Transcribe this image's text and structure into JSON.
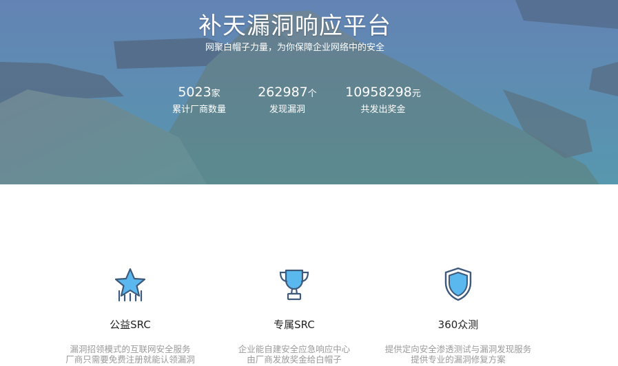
{
  "hero": {
    "title": "补天漏洞响应平台",
    "subtitle": "网聚白帽子力量，为你保障企业网络中的安全",
    "stats": [
      {
        "value": "5023",
        "unit": "家",
        "label": "累计厂商数量"
      },
      {
        "value": "262987",
        "unit": "个",
        "label": "发现漏洞"
      },
      {
        "value": "10958298",
        "unit": "元",
        "label": "共发出奖金"
      }
    ]
  },
  "features": [
    {
      "icon": "star-icon",
      "title": "公益SRC",
      "lines": [
        "漏洞招领模式的互联网安全服务",
        "厂商只需要免费注册就能认领漏洞"
      ]
    },
    {
      "icon": "trophy-icon",
      "title": "专属SRC",
      "lines": [
        "企业能自建安全应急响应中心",
        "由厂商发放奖金给白帽子"
      ]
    },
    {
      "icon": "shield-icon",
      "title": "360众测",
      "lines": [
        "提供定向安全渗透测试与漏洞发现服务",
        "提供专业的漏洞修复方案"
      ]
    }
  ],
  "colors": {
    "icon_stroke": "#3d5a7a",
    "icon_fill": "#5ab8ee",
    "hero_tint": "#5a86a6",
    "desc_text": "#9a9a9a"
  }
}
